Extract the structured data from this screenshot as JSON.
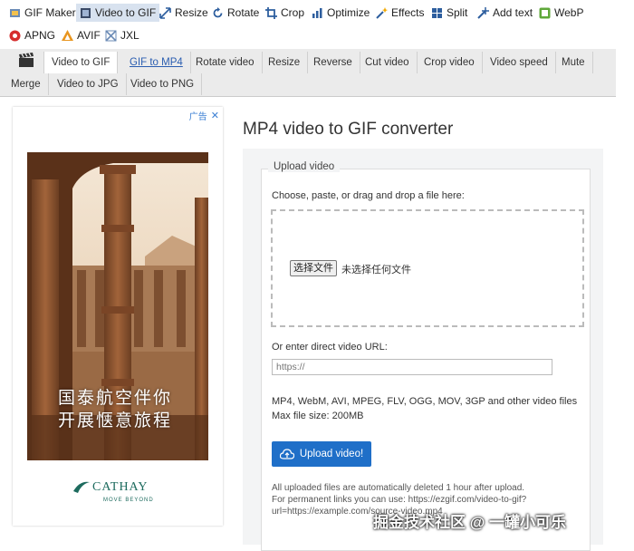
{
  "top_nav": {
    "row1": [
      {
        "label": "GIF Maker",
        "icon": "gif-maker-icon"
      },
      {
        "label": "Video to GIF",
        "icon": "video-icon",
        "active": true
      },
      {
        "label": "Resize",
        "icon": "resize-icon"
      },
      {
        "label": "Rotate",
        "icon": "rotate-icon"
      },
      {
        "label": "Crop",
        "icon": "crop-icon"
      },
      {
        "label": "Optimize",
        "icon": "optimize-icon"
      },
      {
        "label": "Effects",
        "icon": "effects-icon"
      },
      {
        "label": "Split",
        "icon": "split-icon"
      },
      {
        "label": "Add text",
        "icon": "add-text-icon"
      },
      {
        "label": "WebP",
        "icon": "webp-icon"
      }
    ],
    "row2": [
      {
        "label": "APNG",
        "icon": "apng-icon"
      },
      {
        "label": "AVIF",
        "icon": "avif-icon"
      },
      {
        "label": "JXL",
        "icon": "jxl-icon"
      }
    ]
  },
  "sub_nav": {
    "row1": [
      "Video to GIF",
      "GIF to MP4",
      "Rotate video",
      "Resize",
      "Reverse",
      "Cut video",
      "Crop video",
      "Video speed",
      "Mute"
    ],
    "row2": [
      "Merge",
      "Video to JPG",
      "Video to PNG"
    ]
  },
  "ad": {
    "label": "广告",
    "headline_line1": "国泰航空伴你",
    "headline_line2": "开展惬意旅程",
    "brand": "CATHAY",
    "tagline": "MOVE BEYOND"
  },
  "main": {
    "title": "MP4 video to GIF converter",
    "legend": "Upload video",
    "choose_text": "Choose, paste, or drag and drop a file here:",
    "file_button": "选择文件",
    "file_status": "未选择任何文件",
    "url_label": "Or enter direct video URL:",
    "url_placeholder": "https://",
    "formats": "MP4, WebM, AVI, MPEG, FLV, OGG, MOV, 3GP and other video files",
    "max_size": "Max file size: 200MB",
    "upload_button": "Upload video!",
    "note1": "All uploaded files are automatically deleted 1 hour after upload.",
    "note2": "For permanent links you can use: https://ezgif.com/video-to-gif?",
    "note3": "url=https://example.com/source-video.mp4"
  },
  "watermark": "掘金技术社区 @ 一罐小可乐",
  "colors": {
    "accent": "#1f6fc8",
    "subnav_bg": "#ebebeb",
    "active_tab_bg": "#d8e2ef"
  }
}
